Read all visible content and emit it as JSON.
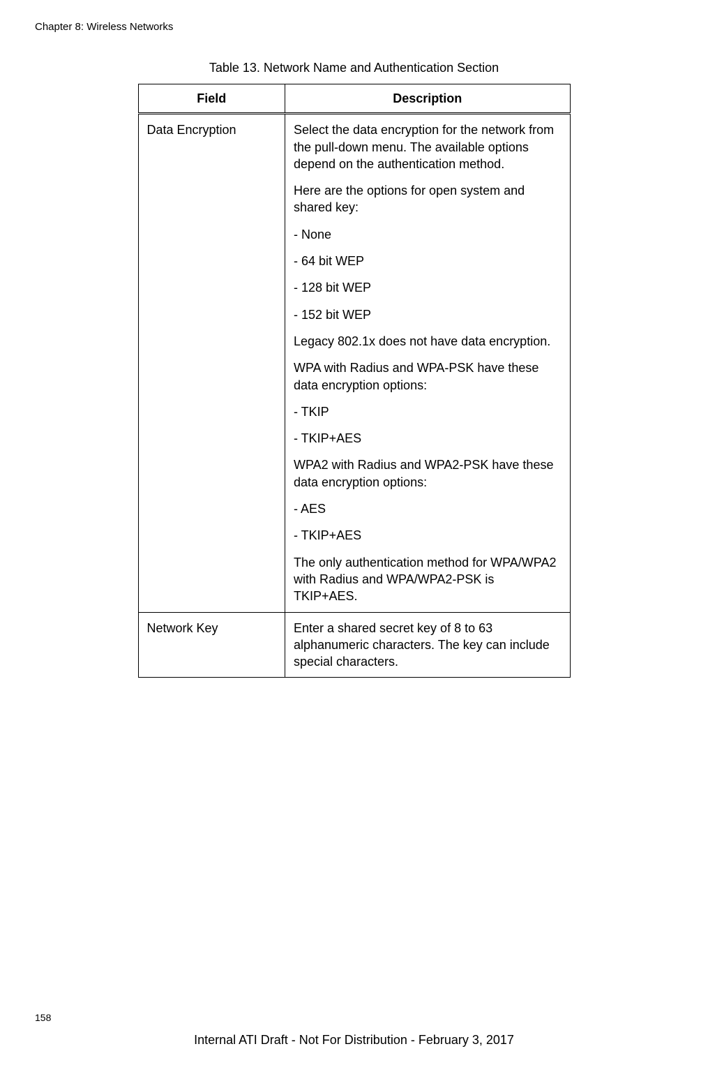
{
  "header": "Chapter 8: Wireless Networks",
  "table": {
    "title": "Table 13. Network Name and Authentication Section",
    "columns": {
      "field": "Field",
      "description": "Description"
    },
    "rows": {
      "row1": {
        "field": "Data Encryption",
        "desc": {
          "p1": "Select the data encryption for the network from the pull-down menu. The available options depend on the authentication method.",
          "p2": "Here are the options for open system and shared key:",
          "p3": "- None",
          "p4": "- 64 bit WEP",
          "p5": "- 128 bit WEP",
          "p6": "- 152 bit WEP",
          "p7": "Legacy 802.1x does not have data encryption.",
          "p8": "WPA with Radius and WPA-PSK have these data encryption options:",
          "p9": "- TKIP",
          "p10": "- TKIP+AES",
          "p11": "WPA2 with Radius and WPA2-PSK have these data encryption options:",
          "p12": "- AES",
          "p13": "- TKIP+AES",
          "p14": "The only authentication method for WPA/WPA2 with Radius and WPA/WPA2-PSK is TKIP+AES."
        }
      },
      "row2": {
        "field": "Network Key",
        "desc": {
          "p1": "Enter a shared secret key of 8 to 63 alphanumeric characters. The key can include special characters."
        }
      }
    }
  },
  "pageNumber": "158",
  "footer": "Internal ATI Draft - Not For Distribution - February 3, 2017"
}
